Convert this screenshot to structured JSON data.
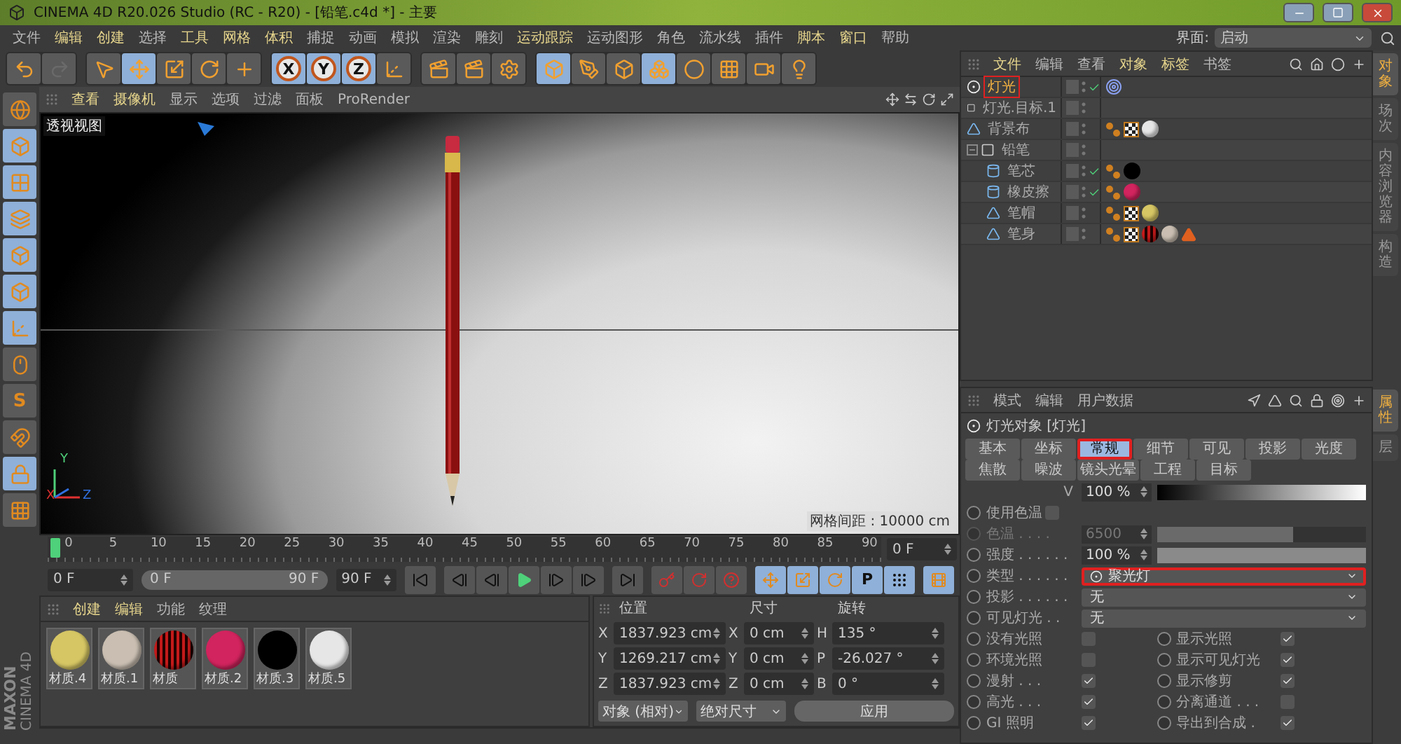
{
  "window": {
    "title": "CINEMA 4D R20.026 Studio (RC - R20) - [铅笔.c4d *] - 主要"
  },
  "menu": [
    {
      "label": "文件",
      "emphasized": false
    },
    {
      "label": "编辑",
      "emphasized": true
    },
    {
      "label": "创建",
      "emphasized": true
    },
    {
      "label": "选择",
      "emphasized": false
    },
    {
      "label": "工具",
      "emphasized": true
    },
    {
      "label": "网格",
      "emphasized": true
    },
    {
      "label": "体积",
      "emphasized": true
    },
    {
      "label": "捕捉",
      "emphasized": false
    },
    {
      "label": "动画",
      "emphasized": false
    },
    {
      "label": "模拟",
      "emphasized": false
    },
    {
      "label": "渲染",
      "emphasized": false
    },
    {
      "label": "雕刻",
      "emphasized": false
    },
    {
      "label": "运动跟踪",
      "emphasized": true
    },
    {
      "label": "运动图形",
      "emphasized": false
    },
    {
      "label": "角色",
      "emphasized": false
    },
    {
      "label": "流水线",
      "emphasized": false
    },
    {
      "label": "插件",
      "emphasized": false
    },
    {
      "label": "脚本",
      "emphasized": true
    },
    {
      "label": "窗口",
      "emphasized": true
    },
    {
      "label": "帮助",
      "emphasized": false
    }
  ],
  "layout_selector": {
    "label": "界面:",
    "value": "启动"
  },
  "toolbar": [
    [
      {
        "kind": "undo",
        "selected": false,
        "disabled": false
      },
      {
        "kind": "redo",
        "selected": false,
        "disabled": true
      }
    ],
    [
      {
        "kind": "pointer",
        "selected": false,
        "disabled": false
      },
      {
        "kind": "move",
        "selected": true,
        "disabled": false
      },
      {
        "kind": "scale",
        "selected": false,
        "disabled": false
      },
      {
        "kind": "rotate",
        "selected": false,
        "disabled": false
      },
      {
        "kind": "plus",
        "selected": false,
        "disabled": false
      }
    ],
    [
      {
        "kind": "axis",
        "label": "X",
        "selected": true,
        "disabled": false
      },
      {
        "kind": "axis",
        "label": "Y",
        "selected": true,
        "disabled": false
      },
      {
        "kind": "axis",
        "label": "Z",
        "selected": true,
        "disabled": false
      },
      {
        "kind": "coords",
        "selected": false,
        "disabled": false
      }
    ],
    [
      {
        "kind": "render",
        "selected": false,
        "disabled": false
      },
      {
        "kind": "render",
        "selected": false,
        "disabled": false
      },
      {
        "kind": "render-settings",
        "selected": false,
        "disabled": false
      }
    ],
    [
      {
        "kind": "cube",
        "selected": true,
        "disabled": false
      },
      {
        "kind": "pen",
        "selected": false,
        "disabled": false
      },
      {
        "kind": "subdivide",
        "selected": false,
        "disabled": false
      },
      {
        "kind": "array",
        "selected": true,
        "disabled": false
      },
      {
        "kind": "deformer",
        "selected": false,
        "disabled": false
      },
      {
        "kind": "floor",
        "selected": false,
        "disabled": false
      },
      {
        "kind": "camera",
        "selected": false,
        "disabled": false
      },
      {
        "kind": "light",
        "selected": false,
        "disabled": false
      }
    ]
  ],
  "left_tools": [
    {
      "kind": "globe",
      "selected": false
    },
    {
      "kind": "cube",
      "selected": true
    },
    {
      "kind": "checker",
      "selected": true
    },
    {
      "kind": "plane",
      "selected": true
    },
    {
      "kind": "wire-cube",
      "selected": true
    },
    {
      "kind": "solid-cube",
      "selected": true
    },
    {
      "kind": "axis",
      "selected": true
    },
    {
      "kind": "mouse",
      "selected": false
    },
    {
      "kind": "snap",
      "label": "S",
      "selected": false
    },
    {
      "kind": "magnet",
      "selected": false
    },
    {
      "kind": "grid-lock",
      "selected": true
    },
    {
      "kind": "grid-anim",
      "selected": false
    }
  ],
  "logo": {
    "brand": "MAXON",
    "product": "CINEMA 4D"
  },
  "viewport": {
    "menu": [
      {
        "label": "查看",
        "emphasized": true
      },
      {
        "label": "摄像机",
        "emphasized": true
      },
      {
        "label": "显示",
        "emphasized": false
      },
      {
        "label": "选项",
        "emphasized": false
      },
      {
        "label": "过滤",
        "emphasized": false
      },
      {
        "label": "面板",
        "emphasized": false
      },
      {
        "label": "ProRender",
        "emphasized": false
      }
    ],
    "view_name": "透视视图",
    "axis_labels": [
      "Y",
      "X",
      "Z"
    ],
    "grid_spacing": "网格间距 : 10000 cm"
  },
  "timeline": {
    "ticks": [
      "0",
      "5",
      "10",
      "15",
      "20",
      "25",
      "30",
      "35",
      "40",
      "45",
      "50",
      "55",
      "60",
      "65",
      "70",
      "75",
      "80",
      "85",
      "90"
    ],
    "current_frame": "0 F"
  },
  "transport": {
    "start": "0 F",
    "range": {
      "start": "0 F",
      "end": "90 F",
      "level": 1
    },
    "end": "90 F",
    "buttons": [
      [
        {
          "kind": "first"
        }
      ],
      [
        {
          "kind": "prev-key"
        },
        {
          "kind": "prev-frame"
        },
        {
          "kind": "play"
        },
        {
          "kind": "next-frame"
        },
        {
          "kind": "next-key"
        }
      ],
      [
        {
          "kind": "last"
        }
      ],
      [
        {
          "kind": "record"
        },
        {
          "kind": "autokey"
        },
        {
          "kind": "keyset"
        }
      ],
      [
        {
          "kind": "move"
        },
        {
          "kind": "scale"
        },
        {
          "kind": "rotate"
        },
        {
          "kind": "param",
          "label": "P"
        },
        {
          "kind": "points"
        }
      ],
      [
        {
          "kind": "timeline"
        }
      ]
    ]
  },
  "materials": {
    "menu": [
      {
        "label": "创建",
        "emphasized": true
      },
      {
        "label": "编辑",
        "emphasized": true
      },
      {
        "label": "功能",
        "emphasized": false
      },
      {
        "label": "纹理",
        "emphasized": false
      }
    ],
    "items": [
      {
        "name": "材质.4",
        "kind": "plain",
        "color": "#d6c664"
      },
      {
        "name": "材质.1",
        "kind": "plain",
        "color": "#c9beb1"
      },
      {
        "name": "材质",
        "kind": "striped",
        "color": "#c41a1a"
      },
      {
        "name": "材质.2",
        "kind": "plain",
        "color": "#d2245e"
      },
      {
        "name": "材质.3",
        "kind": "plain",
        "color": "#000000"
      },
      {
        "name": "材质.5",
        "kind": "plain",
        "color": "#e6e6e6"
      }
    ]
  },
  "coordinates": {
    "headers": [
      "位置",
      "尺寸",
      "旋转"
    ],
    "rows": [
      {
        "p_axis": "X",
        "position": "1837.923 cm",
        "s_axis": "X",
        "size": "0 cm",
        "r_axis": "H",
        "rotation": "135 °"
      },
      {
        "p_axis": "Y",
        "position": "1269.217 cm",
        "s_axis": "Y",
        "size": "0 cm",
        "r_axis": "P",
        "rotation": "-26.027 °"
      },
      {
        "p_axis": "Z",
        "position": "1837.923 cm",
        "s_axis": "Z",
        "size": "0 cm",
        "r_axis": "B",
        "rotation": "0 °"
      }
    ],
    "mode": "对象 (相对)",
    "size_mode": "绝对尺寸",
    "apply": "应用"
  },
  "objects": {
    "menu": [
      {
        "label": "文件",
        "emphasized": true
      },
      {
        "label": "编辑",
        "emphasized": false
      },
      {
        "label": "查看",
        "emphasized": false
      },
      {
        "label": "对象",
        "emphasized": true
      },
      {
        "label": "标签",
        "emphasized": true
      },
      {
        "label": "书签",
        "emphasized": false
      }
    ],
    "tree": [
      {
        "name": "灯光",
        "kind": "light",
        "selected": true,
        "highlighted": true,
        "checked": true,
        "tags": [
          {
            "kind": "target"
          }
        ]
      },
      {
        "name": "灯光.目标.1",
        "kind": "null",
        "selected": false,
        "highlighted": false,
        "checked": false
      },
      {
        "name": "背景布",
        "kind": "polygon",
        "selected": false,
        "highlighted": false,
        "checked": false,
        "tags": [
          {
            "kind": "phong"
          },
          {
            "kind": "texture"
          },
          {
            "kind": "material",
            "color": "#e6e6e6"
          }
        ]
      },
      {
        "name": "铅笔",
        "kind": "null",
        "selected": false,
        "highlighted": false,
        "checked": false,
        "expanded": true,
        "children": [
          {
            "name": "笔芯",
            "kind": "cylinder",
            "selected": false,
            "highlighted": false,
            "checked": true,
            "tags": [
              {
                "kind": "phong"
              },
              {
                "kind": "material",
                "color": "#000000"
              }
            ]
          },
          {
            "name": "橡皮擦",
            "kind": "cylinder",
            "selected": false,
            "highlighted": false,
            "checked": true,
            "tags": [
              {
                "kind": "phong"
              },
              {
                "kind": "material",
                "color": "#d2245e"
              }
            ]
          },
          {
            "name": "笔帽",
            "kind": "polygon",
            "selected": false,
            "highlighted": false,
            "checked": false,
            "tags": [
              {
                "kind": "phong"
              },
              {
                "kind": "texture"
              },
              {
                "kind": "material",
                "color": "#d6c664"
              }
            ]
          },
          {
            "name": "笔身",
            "kind": "polygon",
            "selected": false,
            "highlighted": false,
            "checked": false,
            "tags": [
              {
                "kind": "phong"
              },
              {
                "kind": "texture"
              },
              {
                "kind": "striped",
                "color": "#c41a1a"
              },
              {
                "kind": "material",
                "color": "#c9beb1"
              },
              {
                "kind": "cone"
              }
            ]
          }
        ]
      }
    ],
    "side_tabs": [
      {
        "label": "对象",
        "selected": true
      },
      {
        "label": "场次",
        "selected": false
      },
      {
        "label": "内容浏览器",
        "selected": false
      },
      {
        "label": "构造",
        "selected": false
      }
    ]
  },
  "attributes": {
    "menu": [
      {
        "label": "模式",
        "emphasized": false
      },
      {
        "label": "编辑",
        "emphasized": false
      },
      {
        "label": "用户数据",
        "emphasized": false
      }
    ],
    "title": "灯光对象 [灯光]",
    "tabs": [
      [
        {
          "label": "基本",
          "selected": false,
          "highlighted": false
        },
        {
          "label": "坐标",
          "selected": false,
          "highlighted": false
        },
        {
          "label": "常规",
          "selected": true,
          "highlighted": true
        },
        {
          "label": "细节",
          "selected": false,
          "highlighted": false
        },
        {
          "label": "可见",
          "selected": false,
          "highlighted": false
        },
        {
          "label": "投影",
          "selected": false,
          "highlighted": false
        },
        {
          "label": "光度",
          "selected": false,
          "highlighted": false
        }
      ],
      [
        {
          "label": "焦散",
          "selected": false,
          "highlighted": false
        },
        {
          "label": "噪波",
          "selected": false,
          "highlighted": false
        },
        {
          "label": "镜头光晕",
          "selected": false,
          "highlighted": false
        },
        {
          "label": "工程",
          "selected": false,
          "highlighted": false
        },
        {
          "label": "目标",
          "selected": false,
          "highlighted": false
        }
      ]
    ],
    "rows": [
      {
        "kind": "gradient",
        "label": "V",
        "value": "100 %"
      },
      {
        "kind": "checkbox",
        "label": "使用色温",
        "checked": false
      },
      {
        "kind": "slider",
        "label": "色温 . . . .",
        "value": "6500",
        "level": 0.65,
        "disabled": true
      },
      {
        "kind": "slider",
        "label": "强度 . . . . . .",
        "value": "100 %",
        "level": 1,
        "disabled": false
      },
      {
        "kind": "dropdown",
        "label": "类型 . . . . . .",
        "value": "聚光灯",
        "with_icon": true,
        "highlighted": true
      },
      {
        "kind": "dropdown",
        "label": "投影 . . . . . .",
        "value": "无",
        "highlighted": false
      },
      {
        "kind": "dropdown",
        "label": "可见灯光 . .",
        "value": "无",
        "highlighted": false
      },
      {
        "kind": "pair",
        "label": "没有光照",
        "checked": false,
        "label2": "显示光照",
        "checked2": true
      },
      {
        "kind": "pair",
        "label": "环境光照",
        "checked": false,
        "label2": "显示可见灯光",
        "checked2": true
      },
      {
        "kind": "pair",
        "label": "漫射 . . .",
        "checked": true,
        "label2": "显示修剪",
        "checked2": true
      },
      {
        "kind": "pair",
        "label": "高光 . . .",
        "checked": true,
        "label2": "分离通道 . . .",
        "checked2": false
      },
      {
        "kind": "pair",
        "label": "GI 照明",
        "checked": true,
        "label2": "导出到合成 .",
        "checked2": true
      }
    ],
    "side_tabs": [
      {
        "label": "属性",
        "selected": true
      },
      {
        "label": "层",
        "selected": false
      }
    ]
  }
}
